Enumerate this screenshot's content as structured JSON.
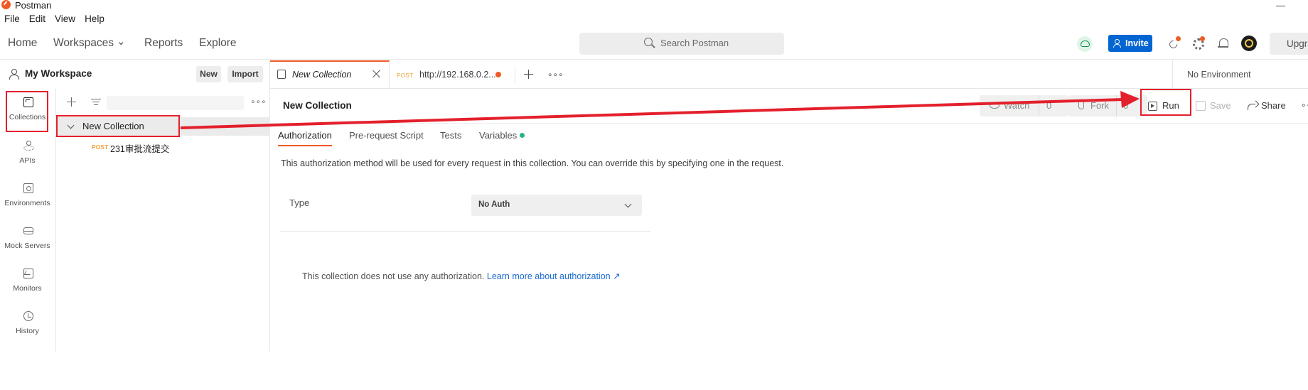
{
  "window": {
    "title": "Postman",
    "minimize_glyph": "—"
  },
  "menu": [
    "File",
    "Edit",
    "View",
    "Help"
  ],
  "header": {
    "nav": [
      "Home",
      "Workspaces",
      "Reports",
      "Explore"
    ],
    "workspaces_chevron": "⌄",
    "search_placeholder": "Search Postman",
    "invite_label": "Invite",
    "upgrade_label": "Upgra"
  },
  "sidebar": {
    "workspace_name": "My Workspace",
    "new_label": "New",
    "import_label": "Import",
    "rail": [
      "Collections",
      "APIs",
      "Environments",
      "Mock Servers",
      "Monitors",
      "History"
    ],
    "more_glyph": "∘∘∘",
    "collection": {
      "name": "New Collection",
      "requests": [
        {
          "method": "POST",
          "name": "231审批流提交"
        }
      ]
    }
  },
  "tabs": {
    "active_label": "New Collection",
    "second_method": "POST",
    "second_label": "http://192.168.0.2...",
    "more_glyph": "∘∘∘",
    "environment": "No Environment"
  },
  "collection_header": {
    "title": "New Collection",
    "watch_label": "Watch",
    "watch_count": "0",
    "fork_label": "Fork",
    "fork_count": "0",
    "run_label": "Run",
    "save_label": "Save",
    "share_label": "Share",
    "more_glyph": "∘∘"
  },
  "subtabs": [
    "Authorization",
    "Pre-request Script",
    "Tests",
    "Variables"
  ],
  "authorization": {
    "description": "This authorization method will be used for every request in this collection. You can override this by specifying one in the request.",
    "type_label": "Type",
    "type_value": "No Auth",
    "no_auth_text": "This collection does not use any authorization.",
    "learn_more": "Learn more about authorization ↗"
  },
  "colors": {
    "accent": "#ef5b25",
    "invite": "#0265d2",
    "link": "#1a6bd1",
    "annotation": "#e3202c",
    "method_post": "#f0a43c"
  }
}
